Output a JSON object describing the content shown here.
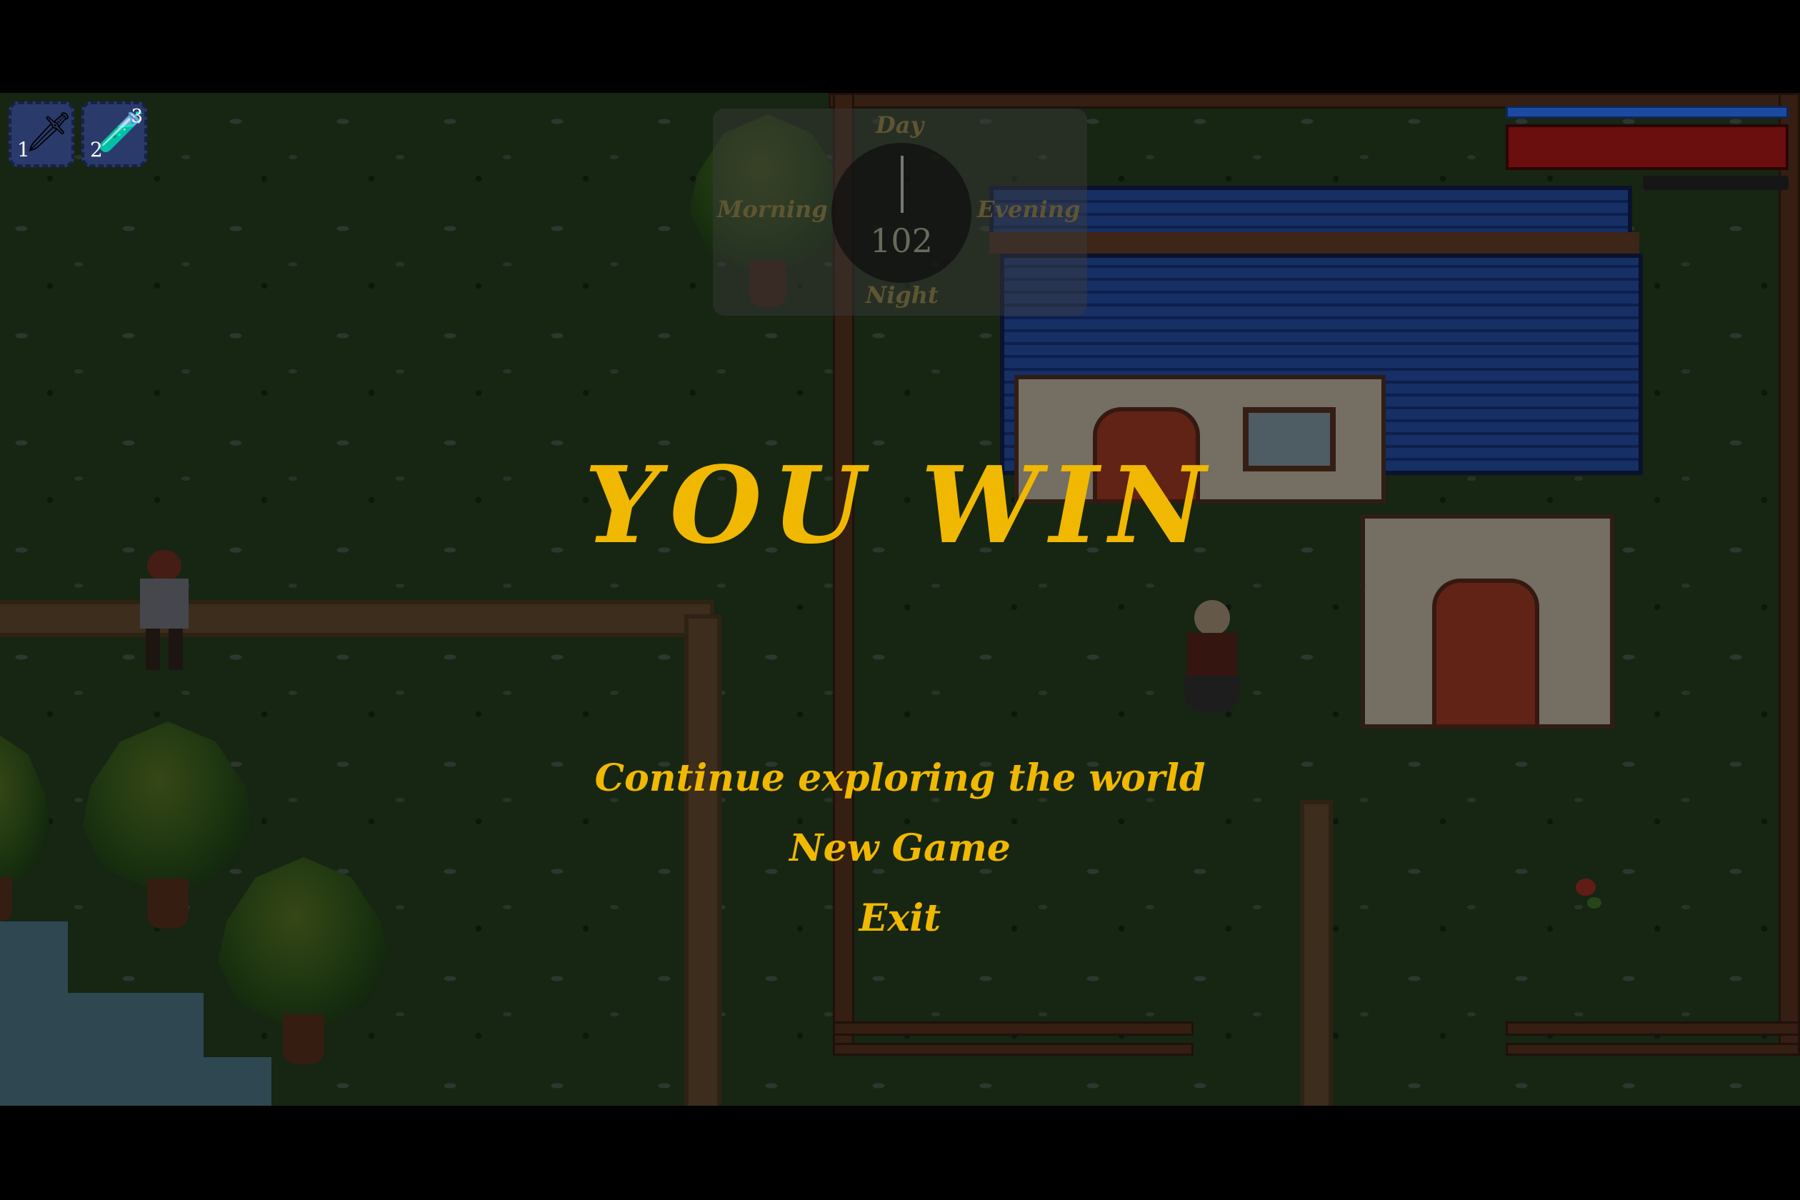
{
  "hud": {
    "hotbar": [
      {
        "icon": "sword-icon",
        "glyph": "🗡",
        "key": "1",
        "count": ""
      },
      {
        "icon": "health-potion-icon",
        "glyph": "🧪",
        "key": "2",
        "count": "3"
      }
    ],
    "clock": {
      "day_number": "102",
      "top_label": "Day",
      "left_label": "Morning",
      "right_label": "Evening",
      "bottom_label": "Night"
    },
    "bars": {
      "mana_fill": 1.0,
      "health_fill": 1.0,
      "mana_color": "#1b4aa0",
      "health_color": "#6b0e0e"
    }
  },
  "overlay": {
    "title": "YOU WIN",
    "menu": [
      {
        "label": "Continue exploring the world"
      },
      {
        "label": "New Game"
      },
      {
        "label": "Exit"
      }
    ],
    "text_color": "#f0b800"
  }
}
